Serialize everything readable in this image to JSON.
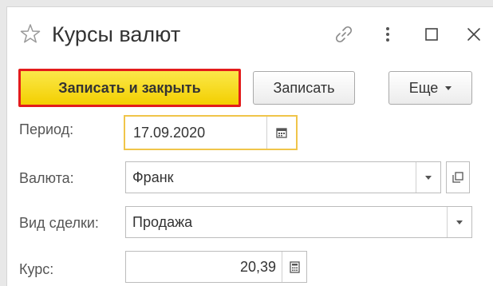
{
  "window": {
    "title": "Курсы валют"
  },
  "toolbar": {
    "save_close_label": "Записать и закрыть",
    "save_label": "Записать",
    "more_label": "Еще"
  },
  "form": {
    "period": {
      "label": "Период:",
      "value": "17.09.2020"
    },
    "currency": {
      "label": "Валюта:",
      "value": "Франк"
    },
    "deal_type": {
      "label": "Вид сделки:",
      "value": "Продажа"
    },
    "rate": {
      "label": "Курс:",
      "value": "20,39"
    }
  },
  "icons": {
    "favorite": "star-icon",
    "link": "link-icon",
    "menu": "more-vertical-icon",
    "maximize": "maximize-icon",
    "close": "close-icon",
    "calendar": "calendar-icon",
    "dropdown": "chevron-down-icon",
    "open": "open-icon",
    "calculator": "calculator-icon"
  },
  "colors": {
    "primary_button": "#f3cf00",
    "primary_button_border": "#e31c1c",
    "focus_border": "#f0c54a"
  }
}
